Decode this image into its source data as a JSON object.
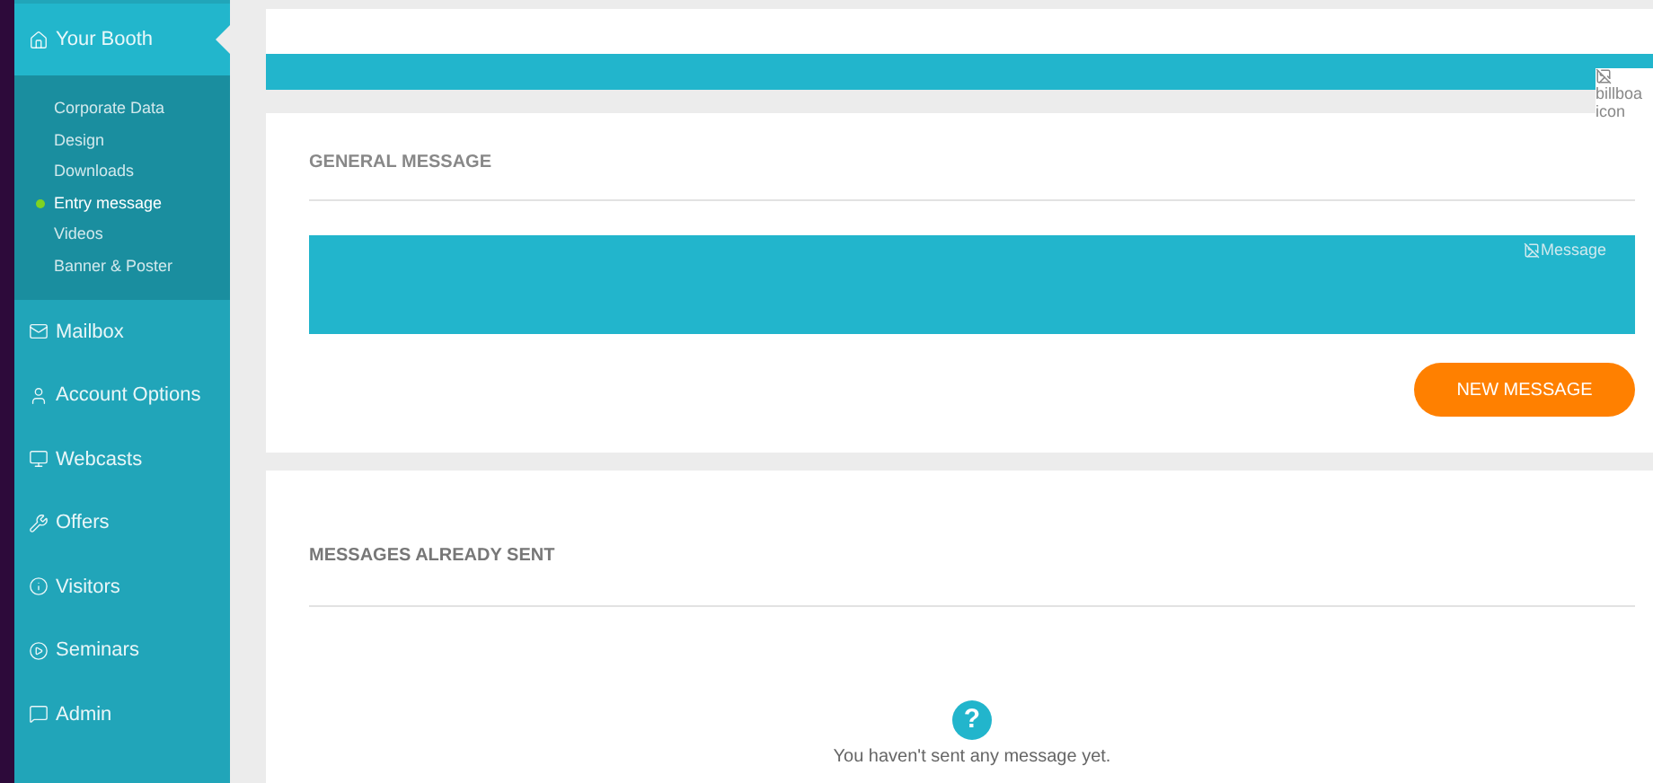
{
  "sidebar": {
    "items": [
      {
        "label": "Your Booth",
        "selected": true,
        "children": [
          {
            "label": "Corporate Data",
            "selected": false
          },
          {
            "label": "Design",
            "selected": false
          },
          {
            "label": "Downloads",
            "selected": false
          },
          {
            "label": "Entry message",
            "selected": true
          },
          {
            "label": "Videos",
            "selected": false
          },
          {
            "label": "Banner & Poster",
            "selected": false
          }
        ]
      },
      {
        "label": "Mailbox",
        "selected": false
      },
      {
        "label": "Account Options",
        "selected": false
      },
      {
        "label": "Webcasts",
        "selected": false
      },
      {
        "label": "Offers",
        "selected": false
      },
      {
        "label": "Visitors",
        "selected": false
      },
      {
        "label": "Seminars",
        "selected": false
      },
      {
        "label": "Admin",
        "selected": false
      }
    ]
  },
  "banner": {
    "image_alt": [
      "billboa",
      "icon"
    ]
  },
  "general_message": {
    "title": "GENERAL MESSAGE",
    "image_alt": "Message",
    "button": "NEW MESSAGE"
  },
  "sent_messages": {
    "title": "MESSAGES ALREADY SENT",
    "empty_icon": "?",
    "empty_text": "You haven't sent any message yet."
  }
}
